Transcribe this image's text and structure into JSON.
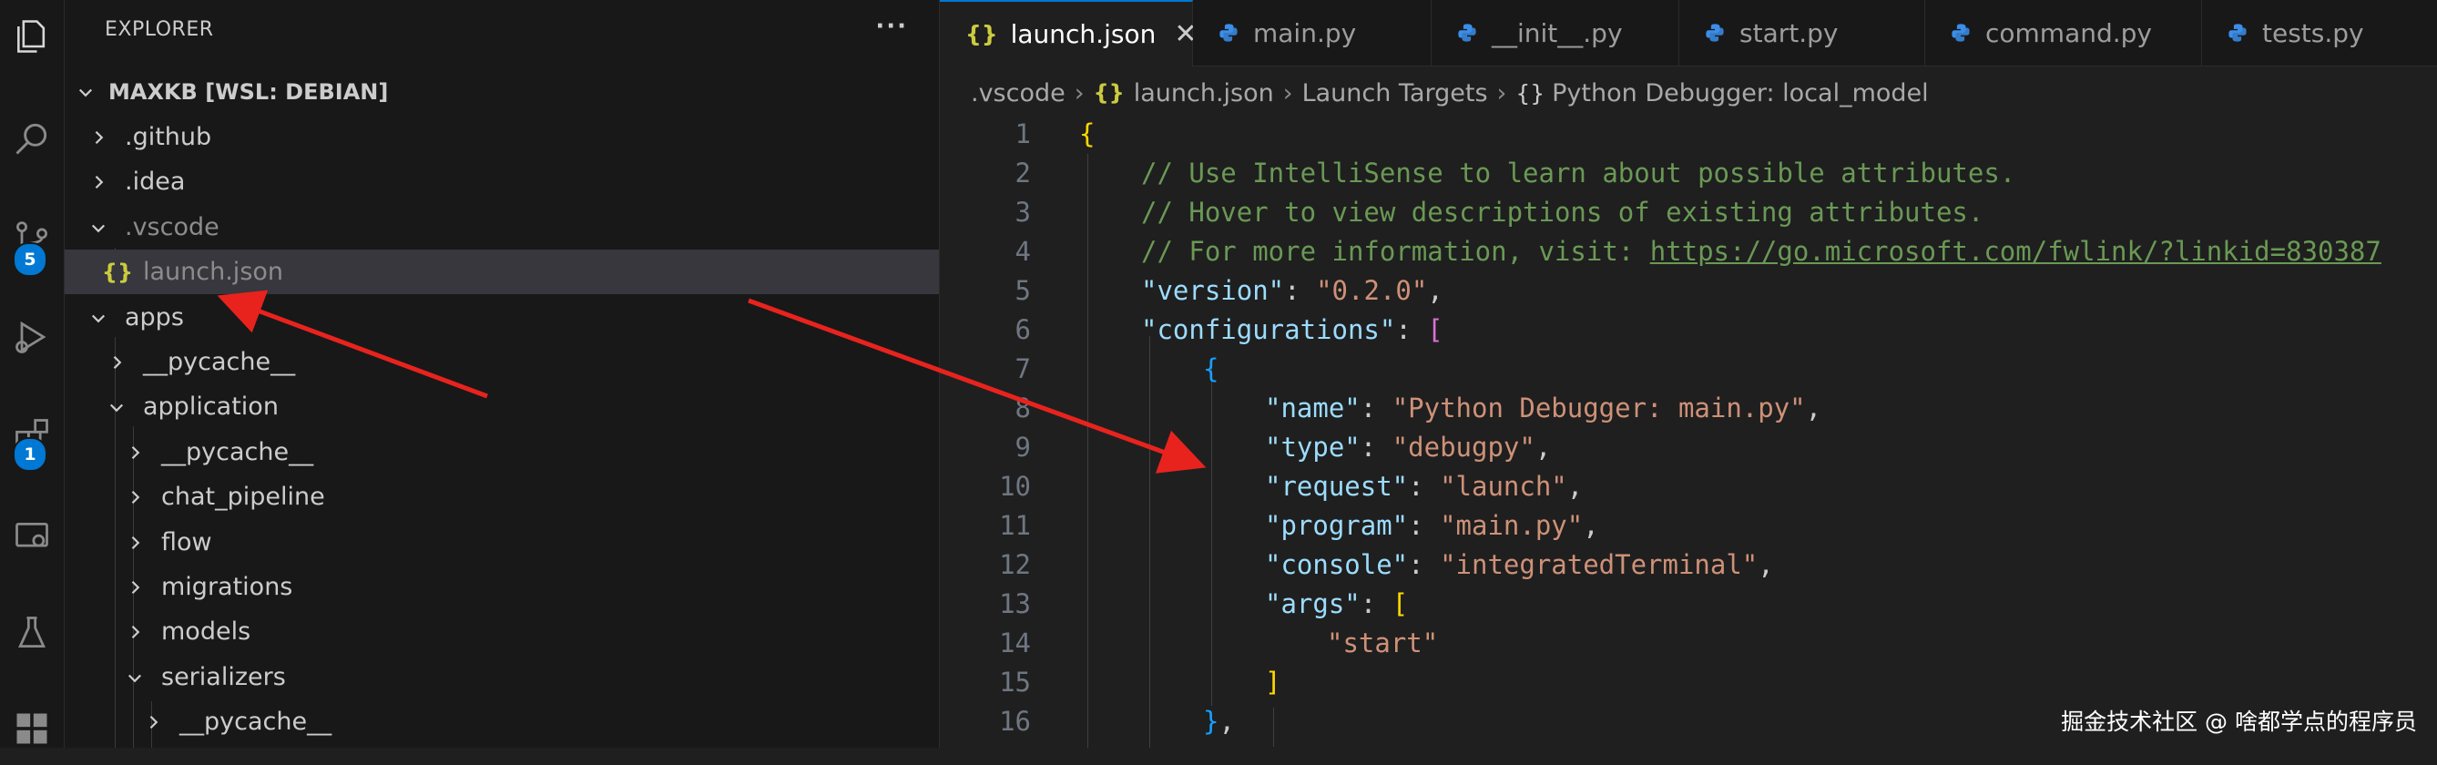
{
  "sidebar": {
    "title": "EXPLORER",
    "more": "···",
    "root": "MAXKB [WSL: DEBIAN]",
    "items": [
      {
        "label": ".github",
        "level": 1,
        "state": "collapsed"
      },
      {
        "label": ".idea",
        "level": 1,
        "state": "collapsed"
      },
      {
        "label": ".vscode",
        "level": 1,
        "state": "expanded"
      },
      {
        "label": "launch.json",
        "level": 2,
        "state": "file",
        "icon": "{}"
      },
      {
        "label": "apps",
        "level": 1,
        "state": "expanded"
      },
      {
        "label": "__pycache__",
        "level": 2,
        "state": "collapsed"
      },
      {
        "label": "application",
        "level": 2,
        "state": "expanded"
      },
      {
        "label": "__pycache__",
        "level": 3,
        "state": "collapsed"
      },
      {
        "label": "chat_pipeline",
        "level": 3,
        "state": "collapsed"
      },
      {
        "label": "flow",
        "level": 3,
        "state": "collapsed"
      },
      {
        "label": "migrations",
        "level": 3,
        "state": "collapsed"
      },
      {
        "label": "models",
        "level": 3,
        "state": "collapsed"
      },
      {
        "label": "serializers",
        "level": 3,
        "state": "expanded"
      },
      {
        "label": "__pycache__",
        "level": 4,
        "state": "collapsed"
      }
    ]
  },
  "activity": {
    "source_control_badge": "5",
    "extensions_badge": "1"
  },
  "tabs": [
    {
      "label": "launch.json",
      "icon": "{}",
      "active": true,
      "close": "✕"
    },
    {
      "label": "main.py",
      "icon": "python"
    },
    {
      "label": "__init__.py",
      "icon": "python"
    },
    {
      "label": "start.py",
      "icon": "python"
    },
    {
      "label": "command.py",
      "icon": "python"
    },
    {
      "label": "tests.py",
      "icon": "python"
    }
  ],
  "breadcrumb": {
    "folder": ".vscode",
    "file_icon": "{}",
    "file": "launch.json",
    "section": "Launch Targets",
    "item_icon": "{}",
    "item": "Python Debugger: local_model"
  },
  "code": {
    "line_numbers": [
      "1",
      "2",
      "3",
      "4",
      "5",
      "6",
      "7",
      "8",
      "9",
      "10",
      "11",
      "12",
      "13",
      "14",
      "15",
      "16"
    ],
    "comment1": "// Use IntelliSense to learn about possible attributes.",
    "comment2": "// Hover to view descriptions of existing attributes.",
    "comment3_prefix": "// For more information, visit: ",
    "comment3_link": "https://go.microsoft.com/fwlink/?linkid=830387",
    "version_key": "\"version\"",
    "version_val": "\"0.2.0\"",
    "configurations_key": "\"configurations\"",
    "name_key": "\"name\"",
    "name_val": "\"Python Debugger: main.py\"",
    "type_key": "\"type\"",
    "type_val": "\"debugpy\"",
    "request_key": "\"request\"",
    "request_val": "\"launch\"",
    "program_key": "\"program\"",
    "program_val": "\"main.py\"",
    "console_key": "\"console\"",
    "console_val": "\"integratedTerminal\"",
    "args_key": "\"args\"",
    "args_val": "\"start\""
  },
  "watermark": "掘金技术社区 @ 啥都学点的程序员",
  "colors": {
    "accent": "#0078d4",
    "annotation_arrow": "#e8231e",
    "json_icon": "#cbcb41",
    "python_icon": "#3b8eea"
  }
}
